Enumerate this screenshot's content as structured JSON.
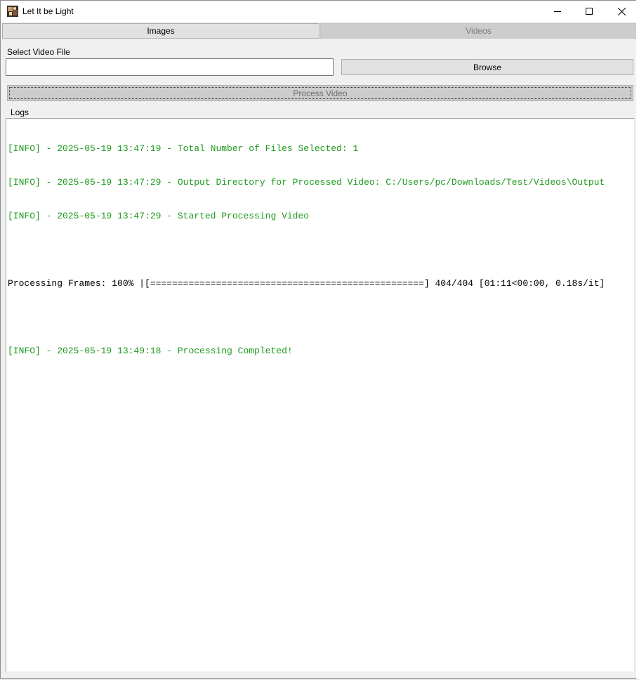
{
  "window": {
    "title": "Let It be Light",
    "app_icon": "app-photo-icon"
  },
  "titlebar_controls": {
    "minimize_icon": "minimize-icon",
    "maximize_icon": "maximize-icon",
    "close_icon": "close-icon"
  },
  "tabs": [
    {
      "label": "Images",
      "selected": false
    },
    {
      "label": "Videos",
      "selected": true
    }
  ],
  "form": {
    "select_label": "Select Video File",
    "file_value": "",
    "browse_label": "Browse",
    "process_label": "Process Video"
  },
  "logs": {
    "label": "Logs",
    "lines": [
      {
        "type": "info",
        "text": "[INFO] - 2025-05-19 13:47:19 - Total Number of Files Selected: 1"
      },
      {
        "type": "info",
        "text": "[INFO] - 2025-05-19 13:47:29 - Output Directory for Processed Video: C:/Users/pc/Downloads/Test/Videos\\Output"
      },
      {
        "type": "info",
        "text": "[INFO] - 2025-05-19 13:47:29 - Started Processing Video"
      },
      {
        "type": "blank",
        "text": ""
      },
      {
        "type": "plain",
        "text": "Processing Frames: 100% |[==================================================] 404/404 [01:11<00:00, 0.18s/it]"
      },
      {
        "type": "blank",
        "text": ""
      },
      {
        "type": "info",
        "text": "[INFO] - 2025-05-19 13:49:18 - Processing Completed!"
      }
    ]
  },
  "colors": {
    "info_text": "#1e9a1e",
    "plain_text": "#000000",
    "disabled_text": "#6d6d6d"
  }
}
